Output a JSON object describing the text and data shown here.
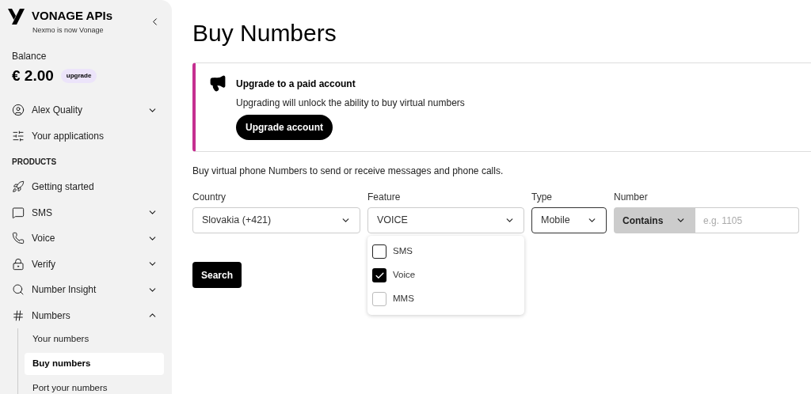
{
  "sidebar": {
    "brand": "VONAGE APIs",
    "tagline": "Nexmo is now Vonage",
    "balance_label": "Balance",
    "balance": "€ 2.00",
    "upgrade_badge": "upgrade",
    "items": [
      {
        "kind": "user",
        "label": "Alex Quality",
        "expanded": false
      },
      {
        "kind": "apps",
        "label": "Your applications"
      },
      {
        "kind": "heading",
        "label": "PRODUCTS"
      },
      {
        "kind": "rocket",
        "label": "Getting started"
      },
      {
        "kind": "sms",
        "label": "SMS",
        "expanded": false
      },
      {
        "kind": "voice",
        "label": "Voice",
        "expanded": false
      },
      {
        "kind": "verify",
        "label": "Verify",
        "expanded": false
      },
      {
        "kind": "insight",
        "label": "Number Insight",
        "expanded": false
      },
      {
        "kind": "numbers",
        "label": "Numbers",
        "expanded": true,
        "children": [
          {
            "label": "Your numbers",
            "selected": false
          },
          {
            "label": "Buy numbers",
            "selected": true
          },
          {
            "label": "Port your numbers",
            "selected": false
          }
        ]
      }
    ]
  },
  "page": {
    "title": "Buy Numbers",
    "banner": {
      "title": "Upgrade to a paid account",
      "text": "Upgrading will unlock the ability to buy virtual numbers",
      "button": "Upgrade account"
    },
    "intro": "Buy virtual phone Numbers to send or receive messages and phone calls.",
    "filters": {
      "country": {
        "label": "Country",
        "value": "Slovakia (+421)",
        "focused": false
      },
      "feature": {
        "label": "Feature",
        "value": "VOICE",
        "focused": false,
        "expanded": true,
        "options": [
          {
            "label": "SMS",
            "checked": false,
            "disabled": false
          },
          {
            "label": "Voice",
            "checked": true,
            "disabled": false
          },
          {
            "label": "MMS",
            "checked": false,
            "disabled": true
          }
        ]
      },
      "type": {
        "label": "Type",
        "value": "Mobile",
        "focused": true
      },
      "number": {
        "label": "Number",
        "match": "Contains",
        "placeholder": "e.g. 1105"
      }
    },
    "search_button": "Search"
  }
}
